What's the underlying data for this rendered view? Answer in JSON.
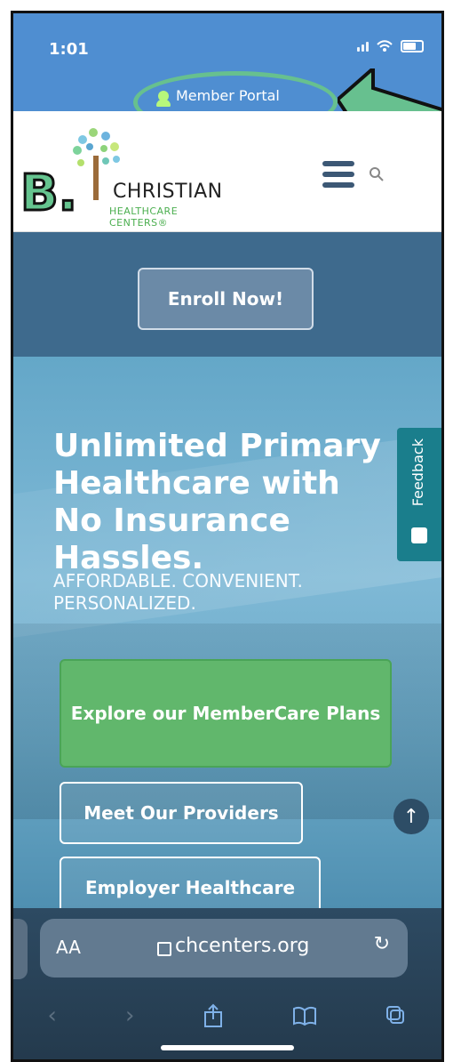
{
  "status_bar": {
    "time": "1:01"
  },
  "top_nav": {
    "member_portal_label": "Member Portal"
  },
  "annotation": {
    "label": "B."
  },
  "logo": {
    "line1": "CHRISTIAN",
    "line2": "HEALTHCARE CENTERS®"
  },
  "enroll": {
    "label": "Enroll Now!"
  },
  "hero": {
    "title_lines": [
      "Unlimited Primary",
      "Healthcare with",
      "No Insurance Hassles."
    ],
    "subtitle_lines": [
      "AFFORDABLE. CONVENIENT.",
      "PERSONALIZED."
    ],
    "explore_button": "Explore our MemberCare Plans",
    "providers_button": "Meet Our Providers",
    "employer_button": "Employer Healthcare"
  },
  "feedback": {
    "label": "Feedback"
  },
  "browser": {
    "aa": "AA",
    "url": "chcenters.org"
  },
  "colors": {
    "accent_green": "#61b76c",
    "header_blue": "#4f8ed1",
    "annotation_green": "#67c08f"
  }
}
